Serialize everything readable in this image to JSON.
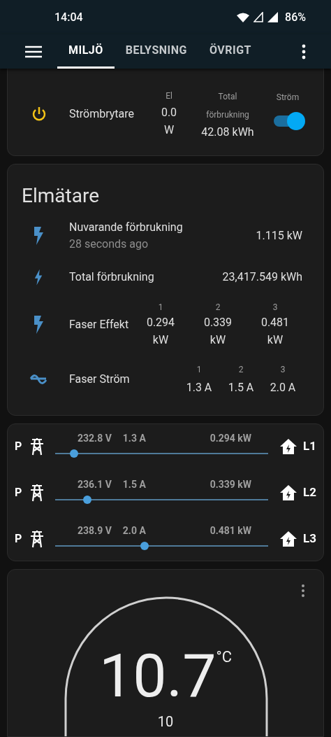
{
  "status_bar": {
    "time": "14:04",
    "battery": "86%"
  },
  "tabs": [
    {
      "label": "MILJÖ",
      "selected": true
    },
    {
      "label": "BELYSNING",
      "selected": false
    },
    {
      "label": "ÖVRIGT",
      "selected": false
    }
  ],
  "switch_card": {
    "name": "Strömbrytare",
    "columns": [
      {
        "header": "El",
        "value": "0.0 W"
      },
      {
        "header": "Total förbrukning",
        "value": "42.08 kWh"
      }
    ],
    "toggle": {
      "header": "Ström",
      "on": true
    }
  },
  "meter_card": {
    "title": "Elmätare",
    "rows": [
      {
        "kind": "single",
        "name": "Nuvarande förbrukning",
        "secondary": "28 seconds ago",
        "value": "1.115 kW"
      },
      {
        "kind": "single",
        "name": "Total förbrukning",
        "value": "23,417.549 kWh"
      },
      {
        "kind": "multi",
        "name": "Faser Effekt",
        "columns": [
          {
            "header": "1",
            "value": "0.294 kW"
          },
          {
            "header": "2",
            "value": "0.339 kW"
          },
          {
            "header": "3",
            "value": "0.481 kW"
          }
        ]
      },
      {
        "kind": "multi",
        "name": "Faser Ström",
        "columns": [
          {
            "header": "1",
            "value": "1.3 A"
          },
          {
            "header": "2",
            "value": "1.5 A"
          },
          {
            "header": "3",
            "value": "2.0 A"
          }
        ]
      }
    ]
  },
  "phases": [
    {
      "source": "P",
      "voltage": "232.8 V",
      "current": "1.3 A",
      "power": "0.294 kW",
      "level": 0.09,
      "target": "L1"
    },
    {
      "source": "P",
      "voltage": "236.1 V",
      "current": "1.5 A",
      "power": "0.339 kW",
      "level": 0.15,
      "target": "L2"
    },
    {
      "source": "P",
      "voltage": "238.9 V",
      "current": "2.0 A",
      "power": "0.481 kW",
      "level": 0.42,
      "target": "L3"
    }
  ],
  "thermostat": {
    "temperature": "10.7",
    "unit": "°C",
    "setpoint": "10"
  }
}
